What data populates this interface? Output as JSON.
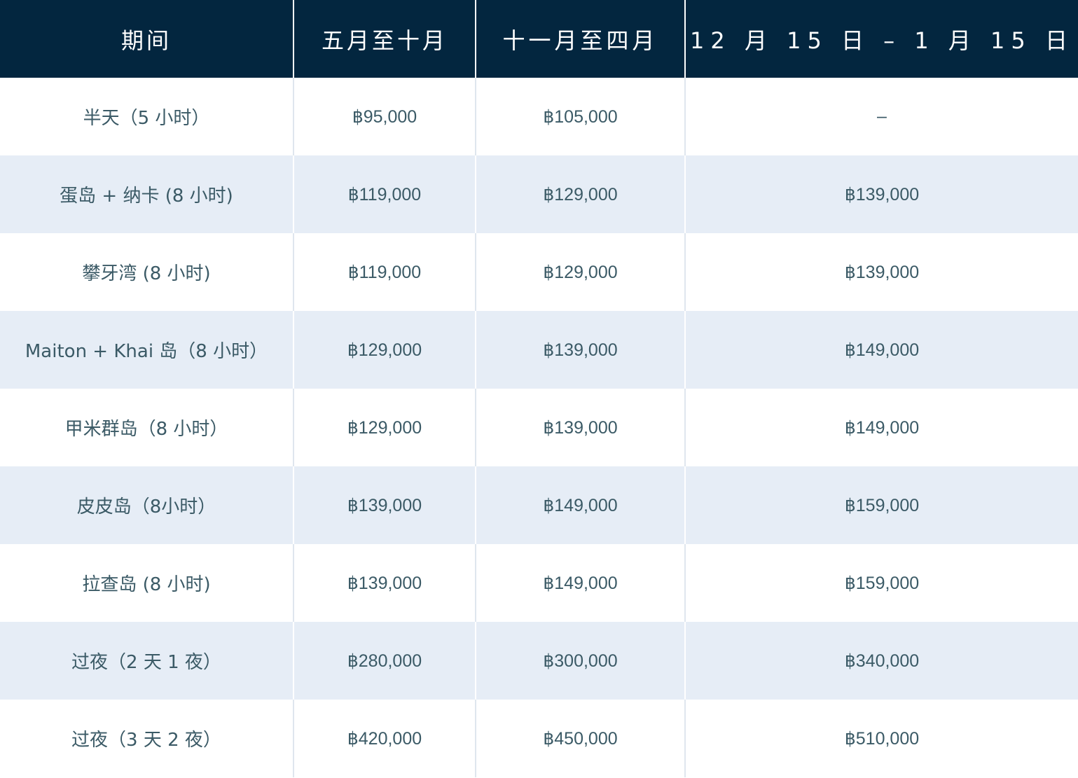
{
  "table": {
    "headers": [
      "期间",
      "五月至十月",
      "十一月至四月",
      "12 月 15 日 – 1 月 15 日"
    ],
    "rows": [
      {
        "trip": "半天（5 小时）",
        "may_oct": "฿95,000",
        "nov_apr": "฿105,000",
        "peak": "–"
      },
      {
        "trip": "蛋岛 + 纳卡 (8 小时)",
        "may_oct": "฿119,000",
        "nov_apr": "฿129,000",
        "peak": "฿139,000"
      },
      {
        "trip": "攀牙湾 (8 小时)",
        "may_oct": "฿119,000",
        "nov_apr": "฿129,000",
        "peak": "฿139,000"
      },
      {
        "trip": "Maiton + Khai 岛（8 小时）",
        "may_oct": "฿129,000",
        "nov_apr": "฿139,000",
        "peak": "฿149,000"
      },
      {
        "trip": "甲米群岛（8 小时）",
        "may_oct": "฿129,000",
        "nov_apr": "฿139,000",
        "peak": "฿149,000"
      },
      {
        "trip": "皮皮岛（8小时）",
        "may_oct": "฿139,000",
        "nov_apr": "฿149,000",
        "peak": "฿159,000"
      },
      {
        "trip": "拉查岛 (8 小时)",
        "may_oct": "฿139,000",
        "nov_apr": "฿149,000",
        "peak": "฿159,000"
      },
      {
        "trip": "过夜（2 天 1 夜）",
        "may_oct": "฿280,000",
        "nov_apr": "฿300,000",
        "peak": "฿340,000"
      },
      {
        "trip": "过夜（3 天 2 夜）",
        "may_oct": "฿420,000",
        "nov_apr": "฿450,000",
        "peak": "฿510,000"
      }
    ]
  },
  "colors": {
    "header_bg": "#03263f",
    "header_text": "#ffffff",
    "body_text": "#3b5a66",
    "row_alt_bg": "#e6edf6",
    "row_bg": "#ffffff"
  }
}
